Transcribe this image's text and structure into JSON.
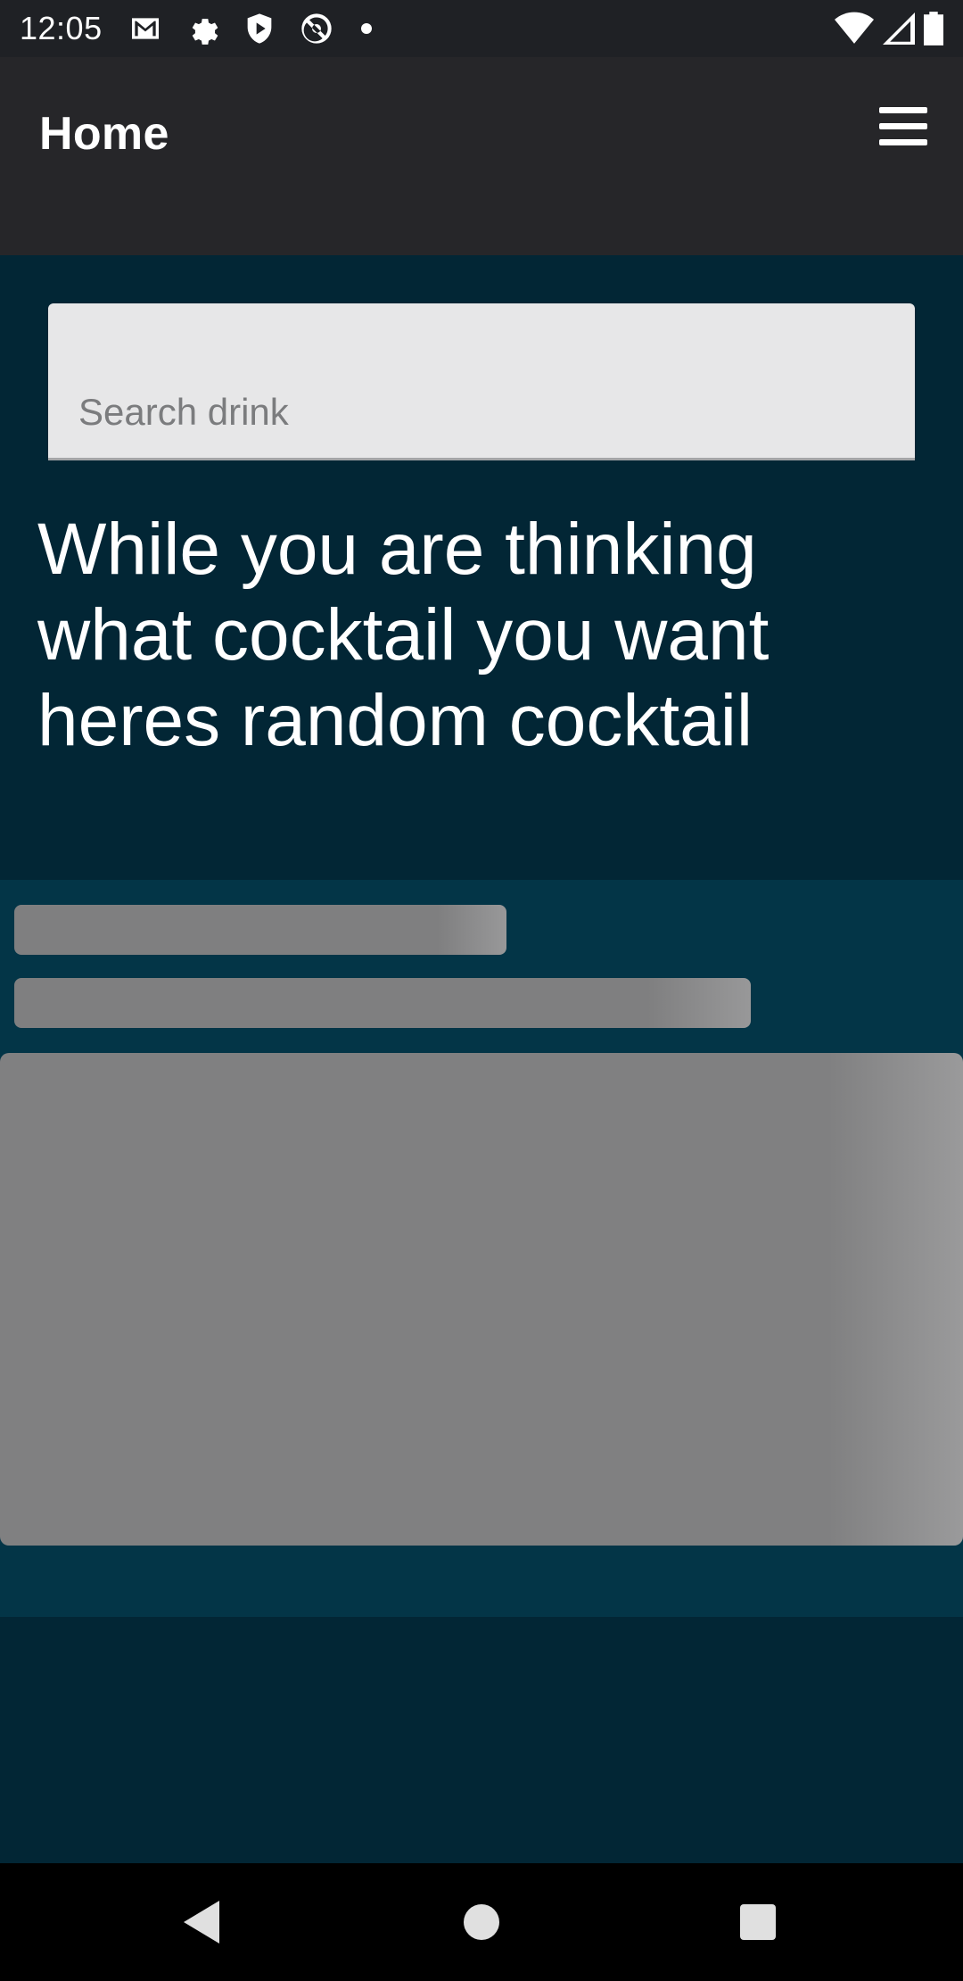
{
  "status_bar": {
    "time": "12:05",
    "left_icons": [
      "gmail-icon",
      "settings-gear-icon",
      "shield-play-icon",
      "at-sign-icon",
      "notification-dot-icon"
    ],
    "right_icons": [
      "wifi-icon",
      "cellular-signal-icon",
      "battery-icon"
    ]
  },
  "app_bar": {
    "title": "Home",
    "menu_icon": "hamburger-menu-icon"
  },
  "search": {
    "placeholder": "Search drink",
    "value": ""
  },
  "headline": "While you are thinking what cocktail you want heres random cocktail",
  "card": {
    "state": "loading-skeleton"
  },
  "nav_bar": {
    "buttons": [
      "back-icon",
      "home-icon",
      "recents-icon"
    ]
  },
  "colors": {
    "background": "#022635",
    "app_bar": "#262629",
    "card": "#033547",
    "skeleton": "#7f7f80"
  }
}
